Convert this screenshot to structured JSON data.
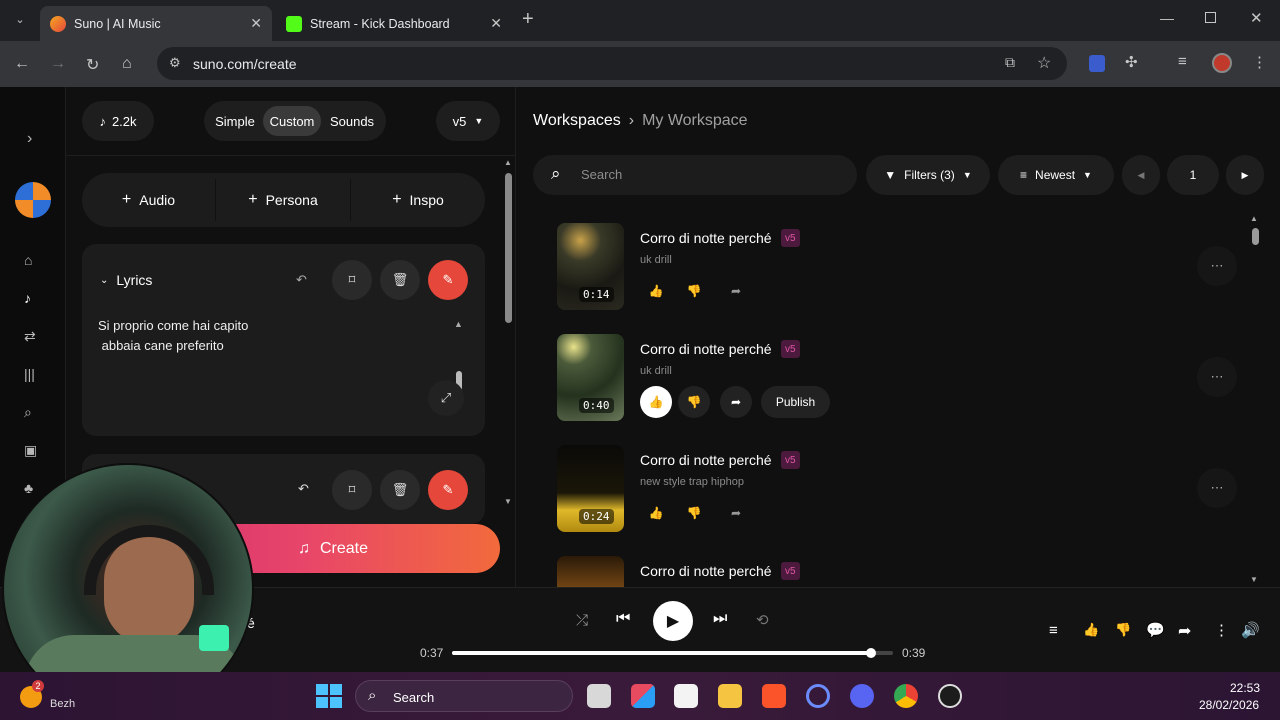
{
  "browser": {
    "tabs": [
      {
        "title": "Suno | AI Music",
        "active": true
      },
      {
        "title": "Stream - Kick Dashboard",
        "active": false
      }
    ],
    "url": "suno.com/create"
  },
  "left": {
    "credits": "2.2k",
    "modes": [
      "Simple",
      "Custom",
      "Sounds"
    ],
    "active_mode": "Custom",
    "version": "v5",
    "adders": [
      "Audio",
      "Persona",
      "Inspo"
    ],
    "lyrics": {
      "header": "Lyrics",
      "line1": "Si proprio come hai capito",
      "line2": " abbaia cane preferito"
    },
    "create_label": "Create"
  },
  "right": {
    "breadcrumb_root": "Workspaces",
    "breadcrumb_current": "My Workspace",
    "search_placeholder": "Search",
    "filters_label": "Filters (3)",
    "sort_label": "Newest",
    "page": "1",
    "publish_label": "Publish",
    "songs": [
      {
        "title": "Corro di notte perché",
        "version": "v5",
        "genre": "uk drill",
        "duration": "0:14"
      },
      {
        "title": "Corro di notte perché",
        "version": "v5",
        "genre": "uk drill",
        "duration": "0:40"
      },
      {
        "title": "Corro di notte perché",
        "version": "v5",
        "genre": "new style trap hiphop",
        "duration": "0:24"
      },
      {
        "title": "Corro di notte perché",
        "version": "v5",
        "genre": "",
        "duration": ""
      }
    ]
  },
  "player": {
    "title_fragment": "é",
    "elapsed": "0:37",
    "total": "0:39",
    "progress": 0.95
  },
  "taskbar": {
    "search_label": "Search",
    "time": "22:53",
    "date": "28/02/2026",
    "weather_badge": "2",
    "weather_text": "Bezh"
  },
  "colors": {
    "accent_red": "#e5483a",
    "badge_pink": "#e256a8",
    "create_gradient": [
      "#e03a7e",
      "#f26a2e"
    ]
  }
}
